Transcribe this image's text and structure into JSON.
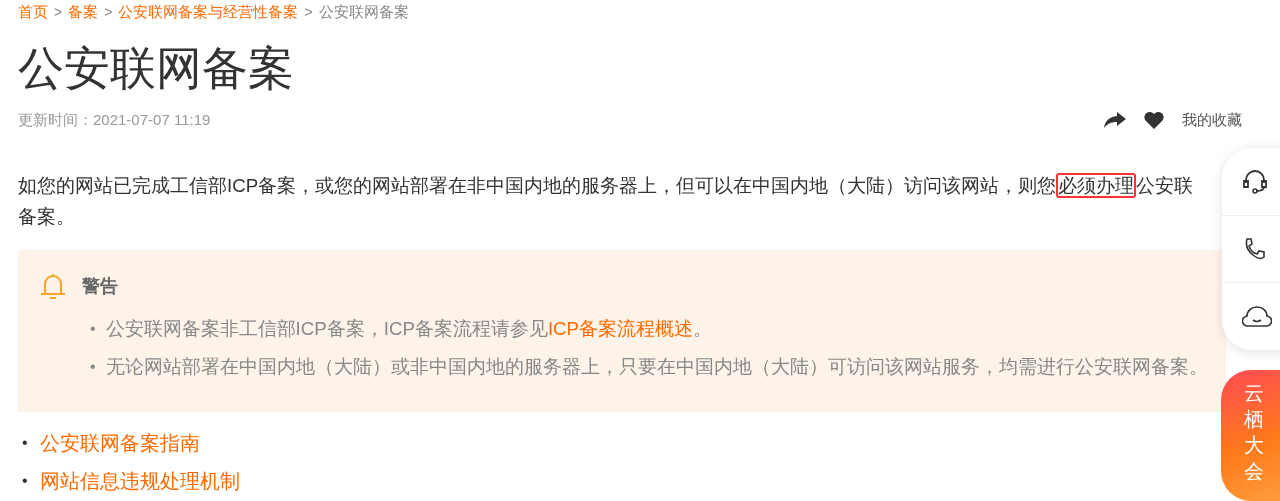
{
  "breadcrumb": [
    {
      "label": "首页",
      "link": true
    },
    {
      "label": "备案",
      "link": true,
      "separator": ">"
    },
    {
      "label": "公安联网备案与经营性备案",
      "link": true,
      "separator": ">"
    },
    {
      "label": "公安联网备案",
      "link": false,
      "separator": ">"
    }
  ],
  "bullet": "•",
  "title": "公安联网备案",
  "updated": "更新时间：2021-07-07 11:19",
  "actions": {
    "favorite": "我的收藏"
  },
  "paragraph": {
    "before": "如您的网站已完成工信部ICP备案，或您的网站部署在非中国内地的服务器上，但可以在中国内地（大陆）访问该网站，则您",
    "highlight": "必须办理",
    "after": "公安联",
    "line2": "备案。"
  },
  "warning": {
    "title": "警告",
    "items": [
      {
        "text": "公安联网备案非工信部ICP备案，ICP备案流程请参见",
        "link": "ICP备案流程概述",
        "tail": "。"
      },
      {
        "text": "无论网站部署在中国内地（大陆）或非中国内地的服务器上，只要在中国内地（大陆）可访问该网站服务，均需进行公安联网备案。"
      }
    ]
  },
  "links": [
    "公安联网备案指南",
    "网站信息违规处理机制"
  ],
  "promo": "云栖大会"
}
